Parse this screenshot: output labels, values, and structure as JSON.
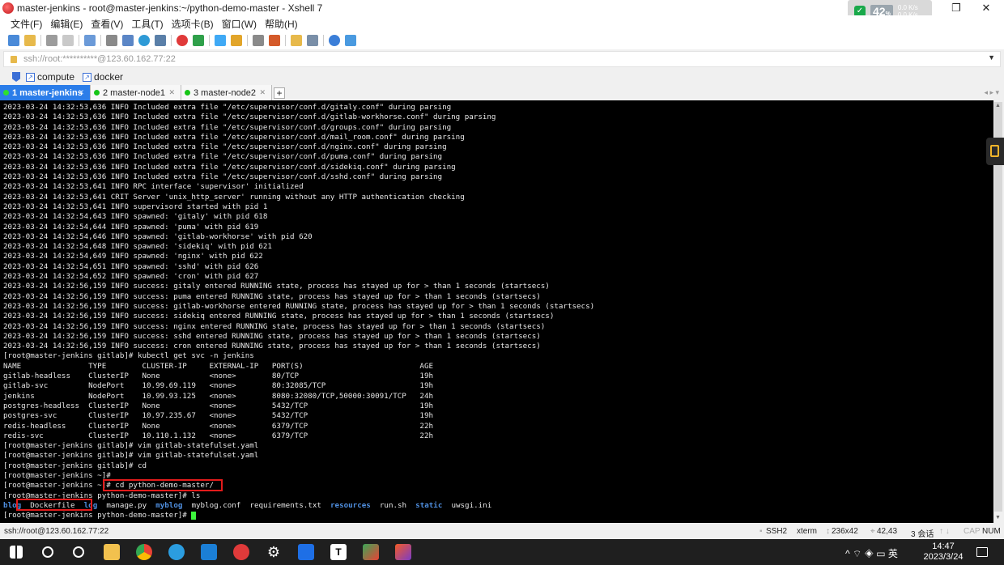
{
  "window": {
    "title": "master-jenkins - root@master-jenkins:~/python-demo-master - Xshell 7",
    "minimize": "—",
    "maximize": "❐",
    "close": "✕"
  },
  "net_widget": {
    "percent": "42",
    "unit": "%",
    "up": "0.0 K/s",
    "down": "0.0 K/s"
  },
  "menu": [
    "文件(F)",
    "编辑(E)",
    "查看(V)",
    "工具(T)",
    "选项卡(B)",
    "窗口(W)",
    "帮助(H)"
  ],
  "address": {
    "value": "ssh://root:**********@123.60.162.77:22"
  },
  "quickbar": {
    "items": [
      "compute",
      "docker"
    ]
  },
  "tabs": [
    {
      "label": "1 master-jenkins",
      "active": true
    },
    {
      "label": "2 master-node1",
      "active": false
    },
    {
      "label": "3 master-node2",
      "active": false
    }
  ],
  "terminal": {
    "lines": [
      "2023-03-24 14:32:53,636 INFO Included extra file \"/etc/supervisor/conf.d/gitaly.conf\" during parsing",
      "2023-03-24 14:32:53,636 INFO Included extra file \"/etc/supervisor/conf.d/gitlab-workhorse.conf\" during parsing",
      "2023-03-24 14:32:53,636 INFO Included extra file \"/etc/supervisor/conf.d/groups.conf\" during parsing",
      "2023-03-24 14:32:53,636 INFO Included extra file \"/etc/supervisor/conf.d/mail_room.conf\" during parsing",
      "2023-03-24 14:32:53,636 INFO Included extra file \"/etc/supervisor/conf.d/nginx.conf\" during parsing",
      "2023-03-24 14:32:53,636 INFO Included extra file \"/etc/supervisor/conf.d/puma.conf\" during parsing",
      "2023-03-24 14:32:53,636 INFO Included extra file \"/etc/supervisor/conf.d/sidekiq.conf\" during parsing",
      "2023-03-24 14:32:53,636 INFO Included extra file \"/etc/supervisor/conf.d/sshd.conf\" during parsing",
      "2023-03-24 14:32:53,641 INFO RPC interface 'supervisor' initialized",
      "2023-03-24 14:32:53,641 CRIT Server 'unix_http_server' running without any HTTP authentication checking",
      "2023-03-24 14:32:53,641 INFO supervisord started with pid 1",
      "2023-03-24 14:32:54,643 INFO spawned: 'gitaly' with pid 618",
      "2023-03-24 14:32:54,644 INFO spawned: 'puma' with pid 619",
      "2023-03-24 14:32:54,646 INFO spawned: 'gitlab-workhorse' with pid 620",
      "2023-03-24 14:32:54,648 INFO spawned: 'sidekiq' with pid 621",
      "2023-03-24 14:32:54,649 INFO spawned: 'nginx' with pid 622",
      "2023-03-24 14:32:54,651 INFO spawned: 'sshd' with pid 626",
      "2023-03-24 14:32:54,652 INFO spawned: 'cron' with pid 627",
      "2023-03-24 14:32:56,159 INFO success: gitaly entered RUNNING state, process has stayed up for > than 1 seconds (startsecs)",
      "2023-03-24 14:32:56,159 INFO success: puma entered RUNNING state, process has stayed up for > than 1 seconds (startsecs)",
      "2023-03-24 14:32:56,159 INFO success: gitlab-workhorse entered RUNNING state, process has stayed up for > than 1 seconds (startsecs)",
      "2023-03-24 14:32:56,159 INFO success: sidekiq entered RUNNING state, process has stayed up for > than 1 seconds (startsecs)",
      "2023-03-24 14:32:56,159 INFO success: nginx entered RUNNING state, process has stayed up for > than 1 seconds (startsecs)",
      "2023-03-24 14:32:56,159 INFO success: sshd entered RUNNING state, process has stayed up for > than 1 seconds (startsecs)",
      "2023-03-24 14:32:56,159 INFO success: cron entered RUNNING state, process has stayed up for > than 1 seconds (startsecs)",
      "[root@master-jenkins gitlab]# kubectl get svc -n jenkins",
      "NAME               TYPE        CLUSTER-IP     EXTERNAL-IP   PORT(S)                          AGE",
      "gitlab-headless    ClusterIP   None           <none>        80/TCP                           19h",
      "gitlab-svc         NodePort    10.99.69.119   <none>        80:32085/TCP                     19h",
      "jenkins            NodePort    10.99.93.125   <none>        8080:32080/TCP,50000:30091/TCP   24h",
      "postgres-headless  ClusterIP   None           <none>        5432/TCP                         19h",
      "postgres-svc       ClusterIP   10.97.235.67   <none>        5432/TCP                         19h",
      "redis-headless     ClusterIP   None           <none>        6379/TCP                         22h",
      "redis-svc          ClusterIP   10.110.1.132   <none>        6379/TCP                         22h",
      "[root@master-jenkins gitlab]# vim gitlab-statefulset.yaml",
      "[root@master-jenkins gitlab]# vim gitlab-statefulset.yaml",
      "[root@master-jenkins gitlab]# cd",
      "[root@master-jenkins ~]#",
      "[root@master-jenkins ~]# cd python-demo-master/",
      "[root@master-jenkins python-demo-master]# ls"
    ],
    "ls_output": [
      {
        "text": "blog",
        "dir": true
      },
      {
        "text": "Dockerfile",
        "dir": false
      },
      {
        "text": "log",
        "dir": true
      },
      {
        "text": "manage.py",
        "dir": false
      },
      {
        "text": "myblog",
        "dir": true
      },
      {
        "text": "myblog.conf",
        "dir": false
      },
      {
        "text": "requirements.txt",
        "dir": false
      },
      {
        "text": "resources",
        "dir": true
      },
      {
        "text": "run.sh",
        "dir": false
      },
      {
        "text": "static",
        "dir": true
      },
      {
        "text": "uwsgi.ini",
        "dir": false
      }
    ],
    "prompt": "[root@master-jenkins python-demo-master]# "
  },
  "statusbar": {
    "connection": "ssh://root@123.60.162.77:22",
    "protocol": "SSH2",
    "terminal": "xterm",
    "size": "236x42",
    "cursor": "42,43",
    "sessions": "3 会话",
    "caps": "CAP",
    "num": "NUM"
  },
  "taskbar": {
    "tray": "^ ⌔ ◈ ▭ 英",
    "time": "14:47",
    "date": "2023/3/24"
  },
  "colors": {
    "tab_active": "#2b7de9",
    "terminal_bg": "#000000",
    "terminal_fg": "#e6e6e6",
    "dir_color": "#4f8fe0",
    "highlight": "#e21b1b",
    "cursor": "#3df53d"
  }
}
